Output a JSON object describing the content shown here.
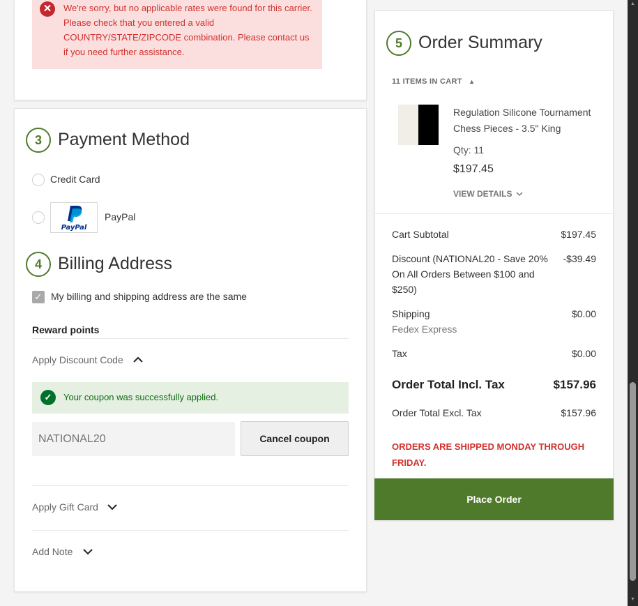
{
  "shipping": {
    "error_message": "We're sorry, but no applicable rates were found for this carrier. Please check that you entered a valid COUNTRY/STATE/ZIPCODE combination. Please contact us if you need further assistance."
  },
  "payment": {
    "step_number": "3",
    "title": "Payment Method",
    "options": [
      {
        "label": "Credit Card"
      },
      {
        "label": "PayPal",
        "logo_text": "PayPal"
      }
    ]
  },
  "billing": {
    "step_number": "4",
    "title": "Billing Address",
    "same_address_label": "My billing and shipping address are the same",
    "same_address_checked": true
  },
  "reward_points_label": "Reward points",
  "discount": {
    "label": "Apply Discount Code",
    "expanded": true,
    "success_message": "Your coupon was successfully applied.",
    "code_value": "NATIONAL20",
    "cancel_label": "Cancel coupon"
  },
  "gift_card": {
    "label": "Apply Gift Card"
  },
  "note": {
    "label": "Add Note"
  },
  "summary": {
    "step_number": "5",
    "title": "Order Summary",
    "items_count_label": "11 ITEMS IN CART",
    "item": {
      "name": "Regulation Silicone Tournament Chess Pieces - 3.5\" King",
      "qty": "Qty: 11",
      "price": "$197.45",
      "view_details": "VIEW DETAILS"
    },
    "rows": {
      "subtotal_label": "Cart Subtotal",
      "subtotal_value": "$197.45",
      "discount_label": "Discount (NATIONAL20 - Save 20% On All Orders Between $100 and $250)",
      "discount_value": "-$39.49",
      "shipping_label": "Shipping",
      "shipping_carrier": "Fedex Express",
      "shipping_value": "$0.00",
      "tax_label": "Tax",
      "tax_value": "$0.00",
      "total_incl_label": "Order Total Incl. Tax",
      "total_incl_value": "$157.96",
      "total_excl_label": "Order Total Excl. Tax",
      "total_excl_value": "$157.96"
    },
    "shipping_notice": "ORDERS ARE SHIPPED MONDAY THROUGH FRIDAY.",
    "place_order_label": "Place Order"
  },
  "colors": {
    "brand_green": "#507a2b",
    "error_red": "#d0312d",
    "success_green": "#0f6b12"
  }
}
